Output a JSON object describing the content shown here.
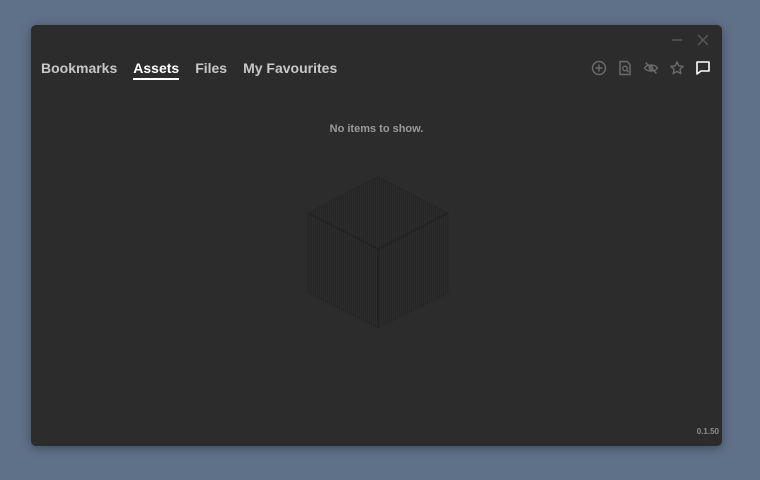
{
  "window": {
    "tabs": [
      {
        "label": "Bookmarks",
        "active": false
      },
      {
        "label": "Assets",
        "active": true
      },
      {
        "label": "Files",
        "active": false
      },
      {
        "label": "My Favourites",
        "active": false
      }
    ],
    "toolbar_icons": [
      "add-circle-icon",
      "file-search-icon",
      "hidden-eye-icon",
      "star-icon",
      "comment-icon"
    ],
    "controls": [
      "minimize-icon",
      "close-icon"
    ],
    "empty_message": "No items to show.",
    "version": "0.1.50"
  },
  "colors": {
    "background": "#5f7189",
    "window": "#2c2c2c",
    "tab_active": "#ffffff",
    "tab_inactive": "#c8c8c8",
    "icon_muted": "#6a6a6a",
    "icon_active": "#ffffff"
  }
}
